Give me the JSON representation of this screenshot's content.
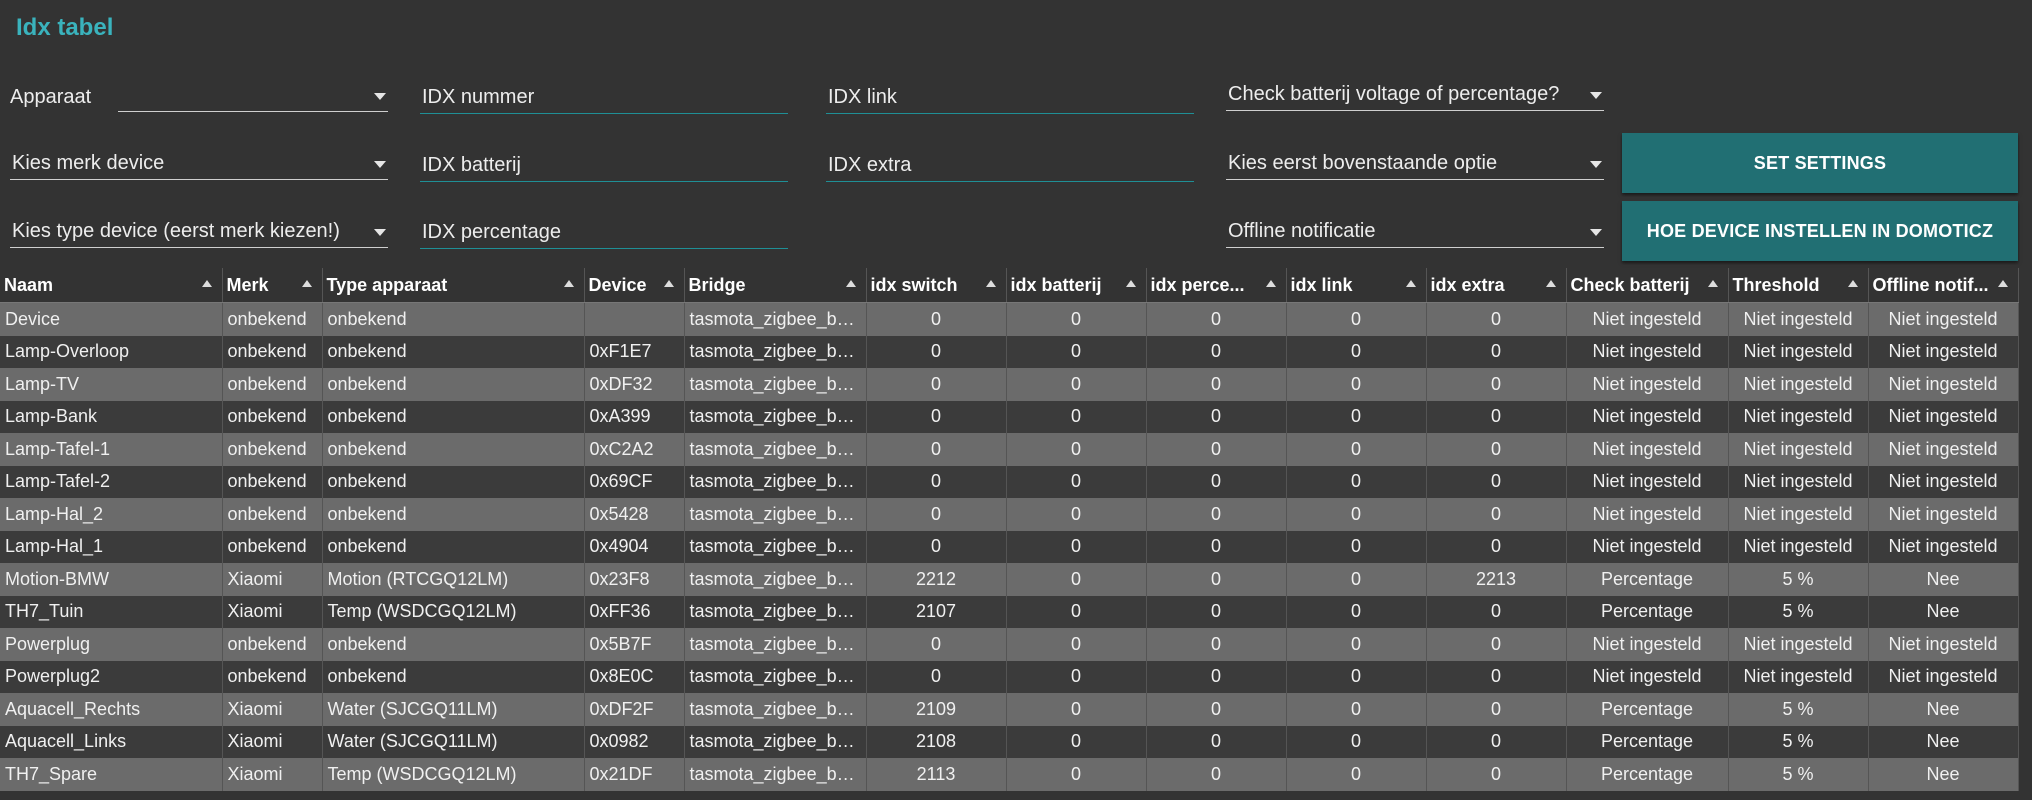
{
  "title": "Idx tabel",
  "form": {
    "apparaat_label": "Apparaat",
    "merk_select": "Kies merk device",
    "type_select": "Kies type device (eerst merk kiezen!)",
    "idx_nummer": "IDX nummer",
    "idx_batterij": "IDX batterij",
    "idx_percentage": "IDX percentage",
    "idx_link": "IDX link",
    "idx_extra": "IDX extra",
    "check_batterij": "Check batterij voltage of percentage?",
    "kies_optie": "Kies eerst bovenstaande optie",
    "offline_notificatie": "Offline notificatie",
    "set_settings": "SET SETTINGS",
    "hoe_device": "HOE DEVICE INSTELLEN IN DOMOTICZ"
  },
  "table": {
    "headers": [
      "Naam",
      "Merk",
      "Type apparaat",
      "Device",
      "Bridge",
      "idx switch",
      "idx batterij",
      "idx perce...",
      "idx link",
      "idx extra",
      "Check batterij",
      "Threshold",
      "Offline notif..."
    ],
    "rows": [
      [
        "Device",
        "onbekend",
        "onbekend",
        "",
        "tasmota_zigbee_bri...",
        "0",
        "0",
        "0",
        "0",
        "0",
        "Niet ingesteld",
        "Niet ingesteld",
        "Niet ingesteld"
      ],
      [
        "Lamp-Overloop",
        "onbekend",
        "onbekend",
        "0xF1E7",
        "tasmota_zigbee_bri...",
        "0",
        "0",
        "0",
        "0",
        "0",
        "Niet ingesteld",
        "Niet ingesteld",
        "Niet ingesteld"
      ],
      [
        "Lamp-TV",
        "onbekend",
        "onbekend",
        "0xDF32",
        "tasmota_zigbee_bri...",
        "0",
        "0",
        "0",
        "0",
        "0",
        "Niet ingesteld",
        "Niet ingesteld",
        "Niet ingesteld"
      ],
      [
        "Lamp-Bank",
        "onbekend",
        "onbekend",
        "0xA399",
        "tasmota_zigbee_bri...",
        "0",
        "0",
        "0",
        "0",
        "0",
        "Niet ingesteld",
        "Niet ingesteld",
        "Niet ingesteld"
      ],
      [
        "Lamp-Tafel-1",
        "onbekend",
        "onbekend",
        "0xC2A2",
        "tasmota_zigbee_bri...",
        "0",
        "0",
        "0",
        "0",
        "0",
        "Niet ingesteld",
        "Niet ingesteld",
        "Niet ingesteld"
      ],
      [
        "Lamp-Tafel-2",
        "onbekend",
        "onbekend",
        "0x69CF",
        "tasmota_zigbee_bri...",
        "0",
        "0",
        "0",
        "0",
        "0",
        "Niet ingesteld",
        "Niet ingesteld",
        "Niet ingesteld"
      ],
      [
        "Lamp-Hal_2",
        "onbekend",
        "onbekend",
        "0x5428",
        "tasmota_zigbee_bri...",
        "0",
        "0",
        "0",
        "0",
        "0",
        "Niet ingesteld",
        "Niet ingesteld",
        "Niet ingesteld"
      ],
      [
        "Lamp-Hal_1",
        "onbekend",
        "onbekend",
        "0x4904",
        "tasmota_zigbee_bri...",
        "0",
        "0",
        "0",
        "0",
        "0",
        "Niet ingesteld",
        "Niet ingesteld",
        "Niet ingesteld"
      ],
      [
        "Motion-BMW",
        "Xiaomi",
        "Motion (RTCGQ12LM)",
        "0x23F8",
        "tasmota_zigbee_bri...",
        "2212",
        "0",
        "0",
        "0",
        "2213",
        "Percentage",
        "5 %",
        "Nee"
      ],
      [
        "TH7_Tuin",
        "Xiaomi",
        "Temp (WSDCGQ12LM)",
        "0xFF36",
        "tasmota_zigbee_bri...",
        "2107",
        "0",
        "0",
        "0",
        "0",
        "Percentage",
        "5 %",
        "Nee"
      ],
      [
        "Powerplug",
        "onbekend",
        "onbekend",
        "0x5B7F",
        "tasmota_zigbee_bri...",
        "0",
        "0",
        "0",
        "0",
        "0",
        "Niet ingesteld",
        "Niet ingesteld",
        "Niet ingesteld"
      ],
      [
        "Powerplug2",
        "onbekend",
        "onbekend",
        "0x8E0C",
        "tasmota_zigbee_bri...",
        "0",
        "0",
        "0",
        "0",
        "0",
        "Niet ingesteld",
        "Niet ingesteld",
        "Niet ingesteld"
      ],
      [
        "Aquacell_Rechts",
        "Xiaomi",
        "Water (SJCGQ11LM)",
        "0xDF2F",
        "tasmota_zigbee_bri...",
        "2109",
        "0",
        "0",
        "0",
        "0",
        "Percentage",
        "5 %",
        "Nee"
      ],
      [
        "Aquacell_Links",
        "Xiaomi",
        "Water (SJCGQ11LM)",
        "0x0982",
        "tasmota_zigbee_bri...",
        "2108",
        "0",
        "0",
        "0",
        "0",
        "Percentage",
        "5 %",
        "Nee"
      ],
      [
        "TH7_Spare",
        "Xiaomi",
        "Temp (WSDCGQ12LM)",
        "0x21DF",
        "tasmota_zigbee_bri...",
        "2113",
        "0",
        "0",
        "0",
        "0",
        "Percentage",
        "5 %",
        "Nee"
      ]
    ]
  },
  "colors": {
    "accent": "#3ab3bd",
    "button": "#216f73",
    "row_light": "#6b6b6b",
    "row_dark": "#3b3b3b",
    "background": "#333333"
  }
}
